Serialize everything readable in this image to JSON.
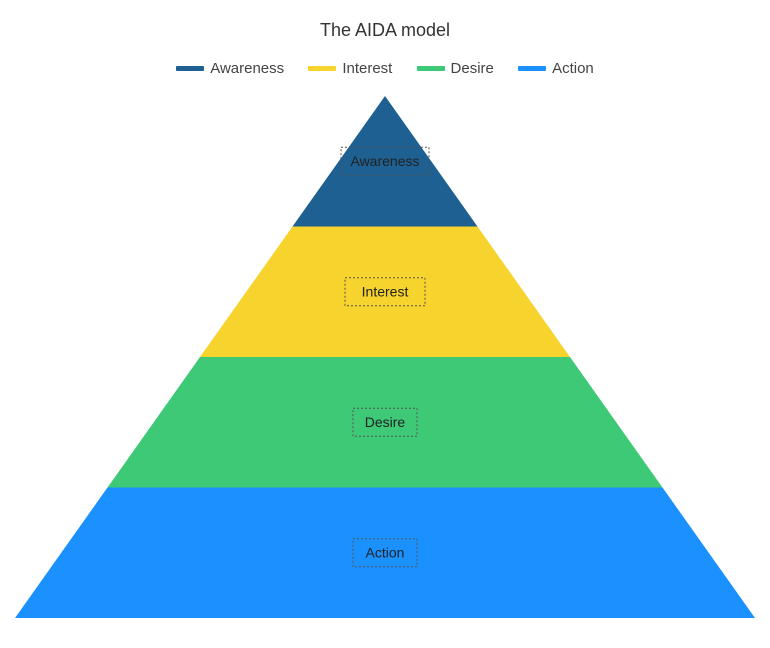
{
  "title": "The AIDA model",
  "legend": [
    {
      "name": "Awareness",
      "color": "#1e6091"
    },
    {
      "name": "Interest",
      "color": "#f6d32d"
    },
    {
      "name": "Desire",
      "color": "#3ec977"
    },
    {
      "name": "Action",
      "color": "#1a91ff"
    }
  ],
  "chart_data": {
    "type": "pyramid",
    "title": "The AIDA model",
    "segments": [
      {
        "name": "Awareness",
        "value": 1,
        "color": "#1e6091"
      },
      {
        "name": "Interest",
        "value": 1,
        "color": "#f6d32d"
      },
      {
        "name": "Desire",
        "value": 1,
        "color": "#3ec977"
      },
      {
        "name": "Action",
        "value": 1,
        "color": "#1a91ff"
      }
    ],
    "note": "Four equal-height stacked bands forming a triangle, top to bottom."
  }
}
